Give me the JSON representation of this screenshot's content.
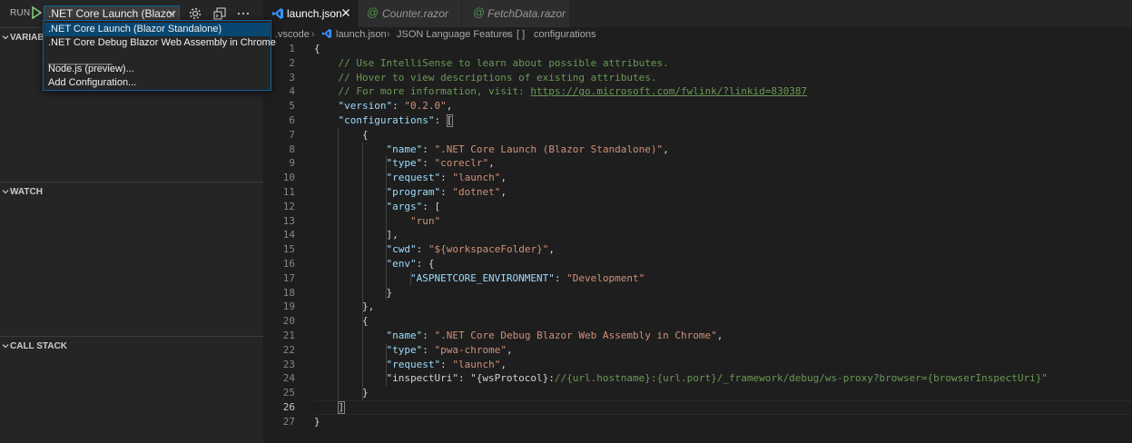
{
  "sidebar": {
    "run_label": "RUN",
    "config_value": ".NET Core Launch (Blazor S",
    "sections": [
      {
        "label": "VARIABLES"
      },
      {
        "label": "WATCH"
      },
      {
        "label": "CALL STACK"
      }
    ]
  },
  "dropdown": {
    "items": [
      {
        "label": ".NET Core Launch (Blazor Standalone)",
        "selected": true
      },
      {
        "label": ".NET Core Debug Blazor Web Assembly in Chrome"
      },
      {
        "label": "Node.js (preview)..."
      },
      {
        "label": "Add Configuration..."
      }
    ],
    "separator": "──────────"
  },
  "tabs": [
    {
      "label": "launch.json",
      "active": true
    },
    {
      "label": "Counter.razor"
    },
    {
      "label": "FetchData.razor"
    }
  ],
  "breadcrumb": {
    "folder": ".vscode",
    "file": "launch.json",
    "section": "JSON Language Features",
    "symbol": "configurations"
  },
  "colors": {
    "comment": "#6a9955",
    "key": "#9cdcfe",
    "string": "#ce9178",
    "accent": "#0e639c"
  },
  "code_lines": [
    "{",
    "    // Use IntelliSense to learn about possible attributes.",
    "    // Hover to view descriptions of existing attributes.",
    "    // For more information, visit: https://go.microsoft.com/fwlink/?linkid=830387",
    "    \"version\": \"0.2.0\",",
    "    \"configurations\": [",
    "        {",
    "            \"name\": \".NET Core Launch (Blazor Standalone)\",",
    "            \"type\": \"coreclr\",",
    "            \"request\": \"launch\",",
    "            \"program\": \"dotnet\",",
    "            \"args\": [",
    "                \"run\"",
    "            ],",
    "            \"cwd\": \"${workspaceFolder}\",",
    "            \"env\": {",
    "                \"ASPNETCORE_ENVIRONMENT\": \"Development\"",
    "            }",
    "        },",
    "        {",
    "            \"name\": \".NET Core Debug Blazor Web Assembly in Chrome\",",
    "            \"type\": \"pwa-chrome\",",
    "            \"request\": \"launch\",",
    "            \"inspectUri\": \"{wsProtocol}://{url.hostname}:{url.port}/_framework/debug/ws-proxy?browser={browserInspectUri}\"",
    "        }",
    "    ]",
    "}"
  ],
  "current_line": 26
}
